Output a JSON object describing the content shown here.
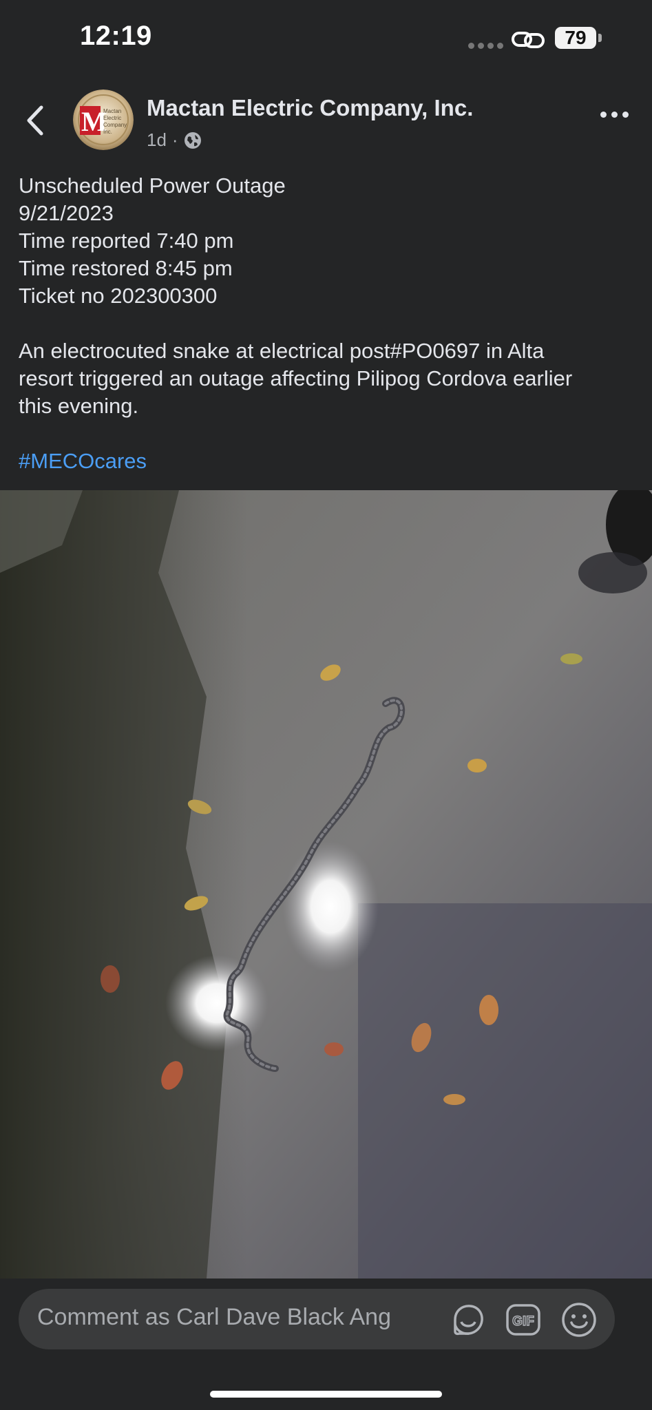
{
  "status_bar": {
    "time": "12:19",
    "battery": "79"
  },
  "post": {
    "page_name": "Mactan Electric Company, Inc.",
    "timestamp": "1d",
    "separator": "·",
    "privacy_icon": "globe-icon",
    "avatar_text": "Mactan Electric Company Inc.",
    "lines": [
      "Unscheduled Power Outage",
      "9/21/2023",
      "Time reported 7:40 pm",
      "Time restored 8:45 pm",
      "Ticket no 202300300"
    ],
    "body": [
      "An electrocuted snake at electrical post#PO0697 in Alta",
      "resort triggered an outage affecting Pilipog Cordova earlier",
      "this evening."
    ],
    "hashtag": "#MECOcares"
  },
  "comment_bar": {
    "placeholder": "Comment as Carl Dave Black Ang",
    "icons": [
      "sticker-icon",
      "gif-icon",
      "emoji-icon"
    ],
    "gif_label": "GIF"
  },
  "colors": {
    "background": "#242526",
    "text": "#e4e6eb",
    "secondary_text": "#b0b3b8",
    "link": "#4b9ef5",
    "comment_box": "#3a3b3c"
  }
}
